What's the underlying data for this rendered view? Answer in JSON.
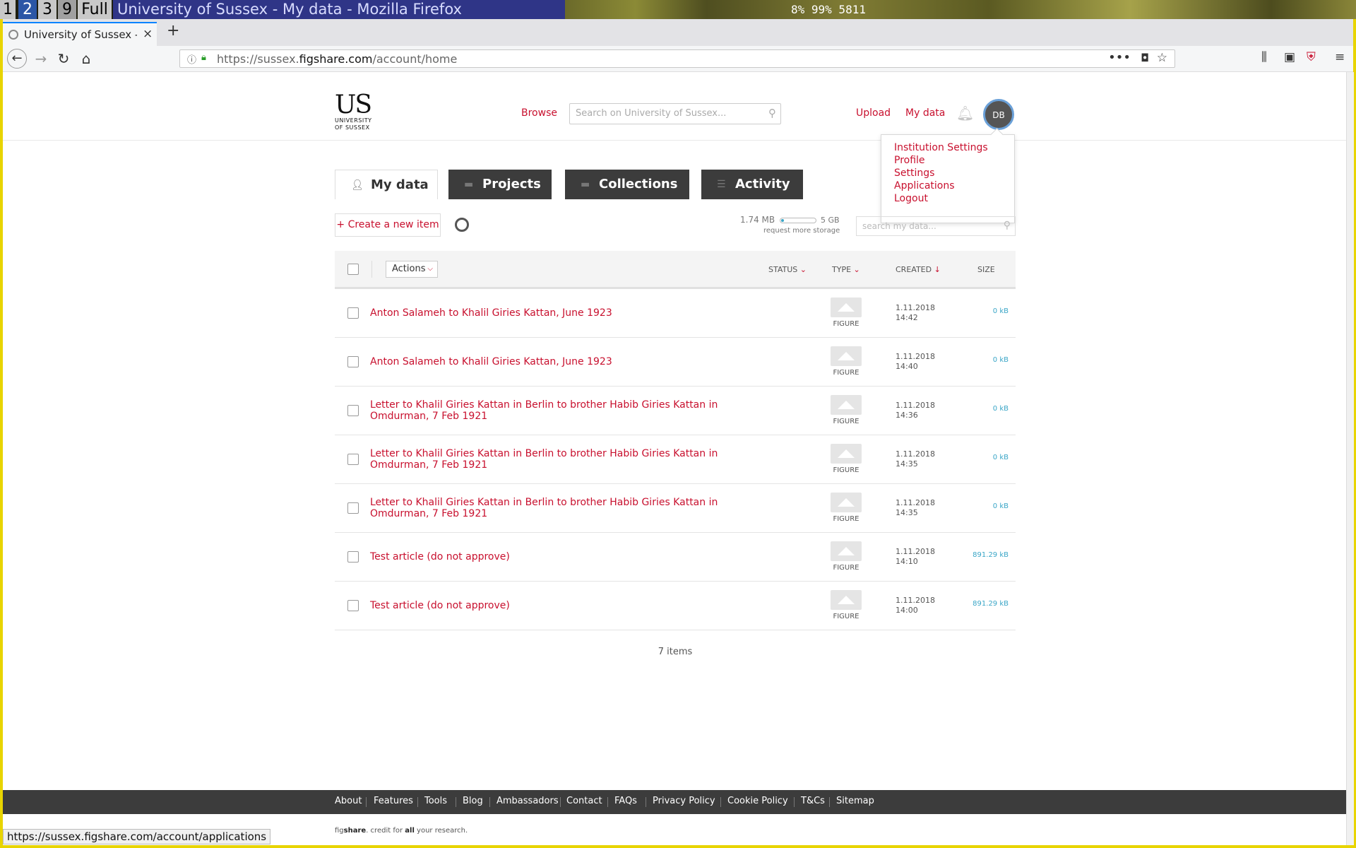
{
  "wm": {
    "workspaces": [
      "1",
      "2",
      "3",
      "9",
      "Full"
    ],
    "title": "University of Sussex - My data - Mozilla Firefox",
    "stats": "8%  99%  5811"
  },
  "browser": {
    "tab_title": "University of Sussex - My data",
    "tab_close": "×",
    "new_tab": "+",
    "url_prefix": "https://sussex.",
    "url_domain": "figshare.com",
    "url_path": "/account/home",
    "status_url": "https://sussex.figshare.com/account/applications"
  },
  "header": {
    "logo_text": "US",
    "logo_line1": "UNIVERSITY",
    "logo_line2": "OF SUSSEX",
    "browse": "Browse",
    "search_placeholder": "Search on University of Sussex...",
    "upload": "Upload",
    "my_data": "My data",
    "avatar_initials": "DB"
  },
  "user_menu": {
    "items": [
      "Institution Settings",
      "Profile",
      "Settings",
      "Applications",
      "Logout"
    ]
  },
  "tabs": {
    "my_data": "My data",
    "projects": "Projects",
    "collections": "Collections",
    "activity": "Activity"
  },
  "toolbar": {
    "create": "+ Create a new item",
    "storage_used": "1.74 MB",
    "storage_fraction": 0.02,
    "storage_total": "5 GB",
    "request_more": "request more storage",
    "search_placeholder": "search my data..."
  },
  "table": {
    "actions": "Actions",
    "headers": {
      "status": "STATUS",
      "type": "TYPE",
      "created": "CREATED",
      "size": "SIZE"
    },
    "rows": [
      {
        "title": "Anton Salameh to Khalil Giries Kattan, June 1923",
        "type": "FIGURE",
        "date": "1.11.2018",
        "time": "14:42",
        "size": "0 kB"
      },
      {
        "title": "Anton Salameh to Khalil Giries Kattan, June 1923",
        "type": "FIGURE",
        "date": "1.11.2018",
        "time": "14:40",
        "size": "0 kB"
      },
      {
        "title": "Letter to Khalil Giries Kattan in Berlin to brother Habib Giries Kattan in Omdurman, 7 Feb 1921",
        "type": "FIGURE",
        "date": "1.11.2018",
        "time": "14:36",
        "size": "0 kB"
      },
      {
        "title": "Letter to Khalil Giries Kattan in Berlin to brother Habib Giries Kattan in Omdurman, 7 Feb 1921",
        "type": "FIGURE",
        "date": "1.11.2018",
        "time": "14:35",
        "size": "0 kB"
      },
      {
        "title": "Letter to Khalil Giries Kattan in Berlin to brother Habib Giries Kattan in Omdurman, 7 Feb 1921",
        "type": "FIGURE",
        "date": "1.11.2018",
        "time": "14:35",
        "size": "0 kB"
      },
      {
        "title": "Test article (do not approve)",
        "type": "FIGURE",
        "date": "1.11.2018",
        "time": "14:10",
        "size": "891.29 kB"
      },
      {
        "title": "Test article (do not approve)",
        "type": "FIGURE",
        "date": "1.11.2018",
        "time": "14:00",
        "size": "891.29 kB"
      }
    ],
    "count": "7 items"
  },
  "footer": {
    "links": [
      "About",
      "Features",
      "Tools",
      "Blog",
      "Ambassadors",
      "Contact",
      "FAQs",
      "Privacy Policy",
      "Cookie Policy",
      "T&Cs",
      "Sitemap"
    ],
    "credit_brand_a": "fig",
    "credit_brand_b": "share",
    "credit_text_a": ". credit for ",
    "credit_bold": "all",
    "credit_text_b": " your research."
  }
}
